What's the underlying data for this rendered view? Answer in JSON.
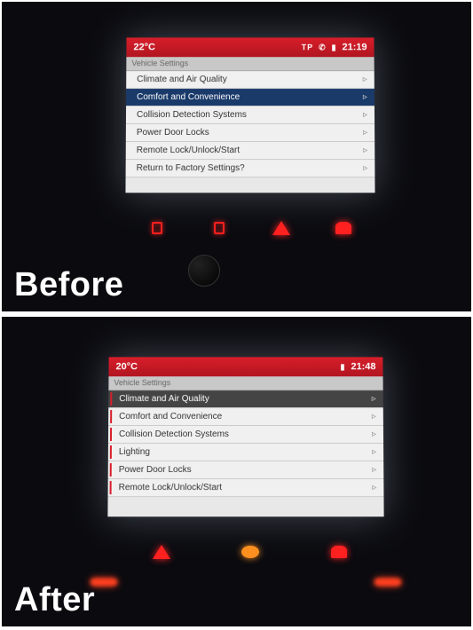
{
  "before": {
    "caption": "Before",
    "header": {
      "temperature": "22°C",
      "status_tp": "TP",
      "time": "21:19"
    },
    "breadcrumb": "Vehicle Settings",
    "menu": [
      {
        "label": "Climate and Air Quality",
        "selected": false
      },
      {
        "label": "Comfort and Convenience",
        "selected": true
      },
      {
        "label": "Collision Detection Systems",
        "selected": false
      },
      {
        "label": "Power Door Locks",
        "selected": false
      },
      {
        "label": "Remote Lock/Unlock/Start",
        "selected": false
      },
      {
        "label": "Return to Factory Settings?",
        "selected": false
      }
    ]
  },
  "after": {
    "caption": "After",
    "header": {
      "temperature": "20°C",
      "time": "21:48"
    },
    "breadcrumb": "Vehicle Settings",
    "menu": [
      {
        "label": "Climate and Air Quality",
        "selected": true,
        "marker": true
      },
      {
        "label": "Comfort and Convenience",
        "selected": false,
        "marker": true
      },
      {
        "label": "Collision Detection Systems",
        "selected": false,
        "marker": true
      },
      {
        "label": "Lighting",
        "selected": false,
        "marker": true
      },
      {
        "label": "Power Door Locks",
        "selected": false,
        "marker": true
      },
      {
        "label": "Remote Lock/Unlock/Start",
        "selected": false,
        "marker": true
      }
    ]
  }
}
